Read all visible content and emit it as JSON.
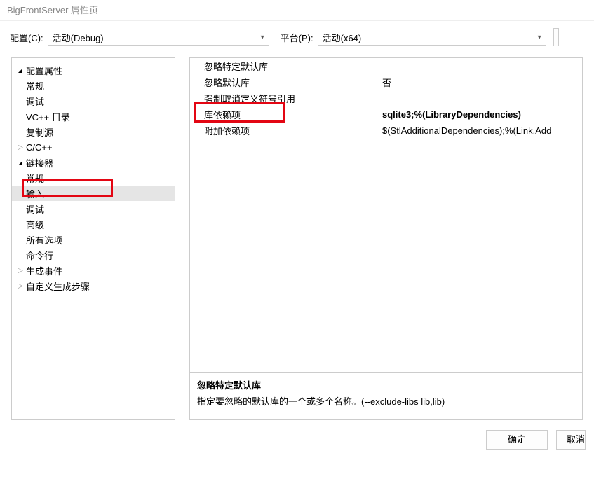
{
  "window": {
    "title": "BigFrontServer 属性页"
  },
  "header": {
    "config_label": "配置(C):",
    "config_value": "活动(Debug)",
    "platform_label": "平台(P):",
    "platform_value": "活动(x64)"
  },
  "tree": {
    "root": "配置属性",
    "items": [
      "常规",
      "调试",
      "VC++ 目录",
      "复制源"
    ],
    "ccpp": "C/C++",
    "linker": "链接器",
    "linker_children": [
      "常规",
      "输入",
      "调试",
      "高级",
      "所有选项",
      "命令行"
    ],
    "build_events": "生成事件",
    "custom_build": "自定义生成步骤"
  },
  "props": {
    "rows": [
      {
        "name": "忽略特定默认库",
        "value": ""
      },
      {
        "name": "忽略默认库",
        "value": "否"
      },
      {
        "name": "强制取消定义符号引用",
        "value": ""
      },
      {
        "name": "库依赖项",
        "value": "sqlite3;%(LibraryDependencies)",
        "bold": true
      },
      {
        "name": "附加依赖项",
        "value": "$(StlAdditionalDependencies);%(Link.Add"
      }
    ]
  },
  "description": {
    "title": "忽略特定默认库",
    "text": "指定要忽略的默认库的一个或多个名称。(--exclude-libs lib,lib)"
  },
  "buttons": {
    "ok": "确定",
    "cancel": "取消"
  }
}
